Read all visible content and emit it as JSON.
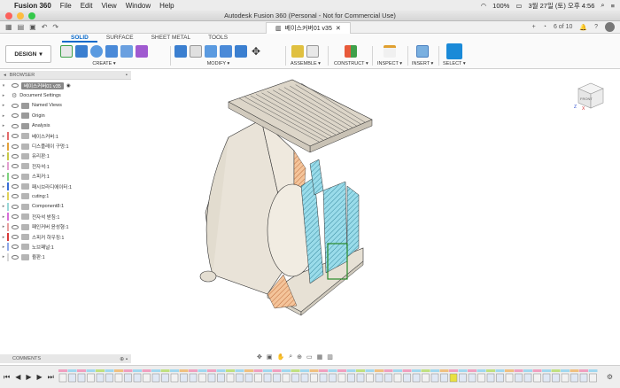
{
  "menubar": {
    "app": "Fusion 360",
    "items": [
      "File",
      "Edit",
      "View",
      "Window",
      "Help"
    ],
    "battery": "100%",
    "datetime": "3월 27일 (토) 오후 4:56"
  },
  "window": {
    "title": "Autodesk Fusion 360 (Personal - Not for Commercial Use)"
  },
  "doc": {
    "tab_label": "베이스커버01 v35",
    "page_count": "6 of 10"
  },
  "ribbon": {
    "workspace": "DESIGN",
    "tabs": [
      "SOLID",
      "SURFACE",
      "SHEET METAL",
      "TOOLS"
    ],
    "groups": {
      "create": "CREATE",
      "modify": "MODIFY",
      "assemble": "ASSEMBLE",
      "construct": "CONSTRUCT",
      "inspect": "INSPECT",
      "insert": "INSERT",
      "select": "SELECT"
    }
  },
  "browser": {
    "title": "BROWSER",
    "root": "베이스커버01 v35",
    "items": [
      {
        "label": "Document Settings",
        "kind": "gear",
        "color": ""
      },
      {
        "label": "Named Views",
        "kind": "folder",
        "color": ""
      },
      {
        "label": "Origin",
        "kind": "folder",
        "color": ""
      },
      {
        "label": "Analysis",
        "kind": "folder",
        "color": ""
      },
      {
        "label": "베이스커버:1",
        "kind": "comp",
        "color": "#e36b6b"
      },
      {
        "label": "디스플레이 구멍:1",
        "kind": "comp",
        "color": "#e3a23a"
      },
      {
        "label": "유리판:1",
        "kind": "comp",
        "color": "#c9c94a"
      },
      {
        "label": "전자석:1",
        "kind": "comp",
        "color": "#e39fd0"
      },
      {
        "label": "스피커:1",
        "kind": "comp",
        "color": "#7fd37f"
      },
      {
        "label": "패시브라디에이터:1",
        "kind": "comp",
        "color": "#3a6fd8"
      },
      {
        "label": "cuting:1",
        "kind": "comp",
        "color": "#e0d25a"
      },
      {
        "label": "Component8:1",
        "kind": "comp",
        "color": "#9ad8d8"
      },
      {
        "label": "전자석 받침:1",
        "kind": "comp",
        "color": "#d86fd8"
      },
      {
        "label": "패인커버 윤성형:1",
        "kind": "comp",
        "color": "#e8a0a0"
      },
      {
        "label": "스피커 하우징:1",
        "kind": "comp",
        "color": "#d83a3a"
      },
      {
        "label": "노브패널:1",
        "kind": "comp",
        "color": "#8fa8e8"
      },
      {
        "label": "퀄판:1",
        "kind": "comp",
        "color": "#d8d8d8"
      }
    ]
  },
  "viewcube": {
    "front": "FRONT",
    "axes": [
      "Z",
      "X"
    ]
  },
  "comments": {
    "title": "COMMENTS"
  },
  "colors": {
    "accent": "#0b6bcb",
    "model_body": "#ece6dc",
    "section_hatch_blue": "#8fd8e8",
    "section_hatch_orange": "#f0b080"
  }
}
